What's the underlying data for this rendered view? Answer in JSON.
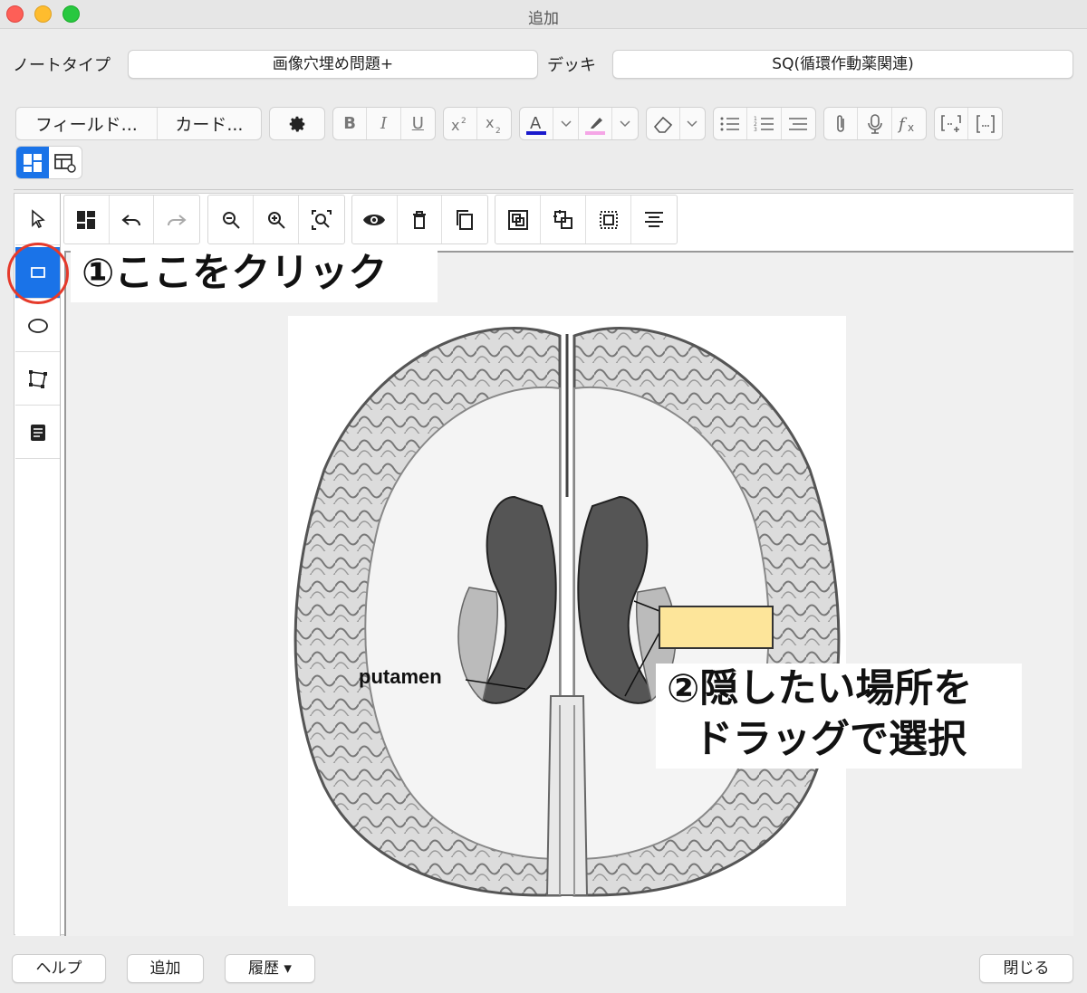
{
  "window": {
    "title": "追加"
  },
  "header": {
    "note_type_label": "ノートタイプ",
    "note_type_value": "画像穴埋め問題+",
    "deck_label": "デッキ",
    "deck_value": "SQ(循環作動薬関連)"
  },
  "toolbar": {
    "fields_label": "フィールド...",
    "cards_label": "カード...",
    "bold": "B",
    "italic": "I",
    "underline": "U"
  },
  "annotations": {
    "step1": "①ここをクリック",
    "step2_line1": "②隠したい場所を",
    "step2_line2": "ドラッグで選択"
  },
  "image": {
    "label_putamen": "putamen",
    "occlusion_color": "#fde59a"
  },
  "footer": {
    "help_label": "ヘルプ",
    "add_label": "追加",
    "history_label": "履歴 ▾",
    "close_label": "閉じる"
  },
  "colors": {
    "accent": "#1a73e8",
    "highlight_circle": "#e53a2b",
    "text_color_bar": "#1a1acc",
    "highlight_color_bar": "#f5a6e6"
  }
}
